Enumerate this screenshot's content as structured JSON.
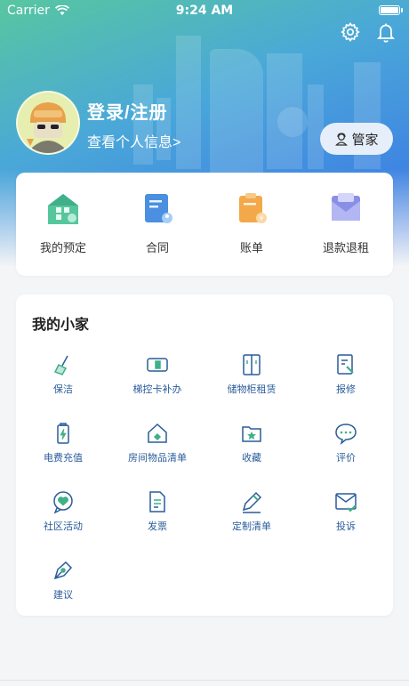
{
  "status_bar": {
    "carrier": "Carrier",
    "time": "9:24 AM"
  },
  "header": {
    "settings_icon": "gear-icon",
    "notification_icon": "bell-icon"
  },
  "profile": {
    "title": "登录/注册",
    "subtitle": "查看个人信息>",
    "steward_label": "管家"
  },
  "quick_actions": [
    {
      "label": "我的预定",
      "icon": "home-booking-icon",
      "color": "#4fc497"
    },
    {
      "label": "合同",
      "icon": "contract-icon",
      "color": "#4a8fe0"
    },
    {
      "label": "账单",
      "icon": "bill-icon",
      "color": "#f3a94a"
    },
    {
      "label": "退款退租",
      "icon": "refund-icon",
      "color": "#8a8fe6"
    }
  ],
  "my_home": {
    "title": "我的小家",
    "items": [
      {
        "label": "保洁",
        "icon": "broom-icon"
      },
      {
        "label": "梯控卡补办",
        "icon": "card-icon"
      },
      {
        "label": "储物柜租赁",
        "icon": "locker-icon"
      },
      {
        "label": "报修",
        "icon": "repair-icon"
      },
      {
        "label": "电费充值",
        "icon": "battery-icon"
      },
      {
        "label": "房间物品清单",
        "icon": "house-list-icon"
      },
      {
        "label": "收藏",
        "icon": "star-folder-icon"
      },
      {
        "label": "评价",
        "icon": "comment-icon"
      },
      {
        "label": "社区活动",
        "icon": "heart-chat-icon"
      },
      {
        "label": "发票",
        "icon": "invoice-icon"
      },
      {
        "label": "定制清单",
        "icon": "pencil-icon"
      },
      {
        "label": "投诉",
        "icon": "mail-icon"
      },
      {
        "label": "建议",
        "icon": "pen-nib-icon"
      }
    ]
  },
  "colors": {
    "accent_blue": "#2a5c9a",
    "icon_teal": "#3fb08a",
    "header_blue": "#3f86e2"
  }
}
